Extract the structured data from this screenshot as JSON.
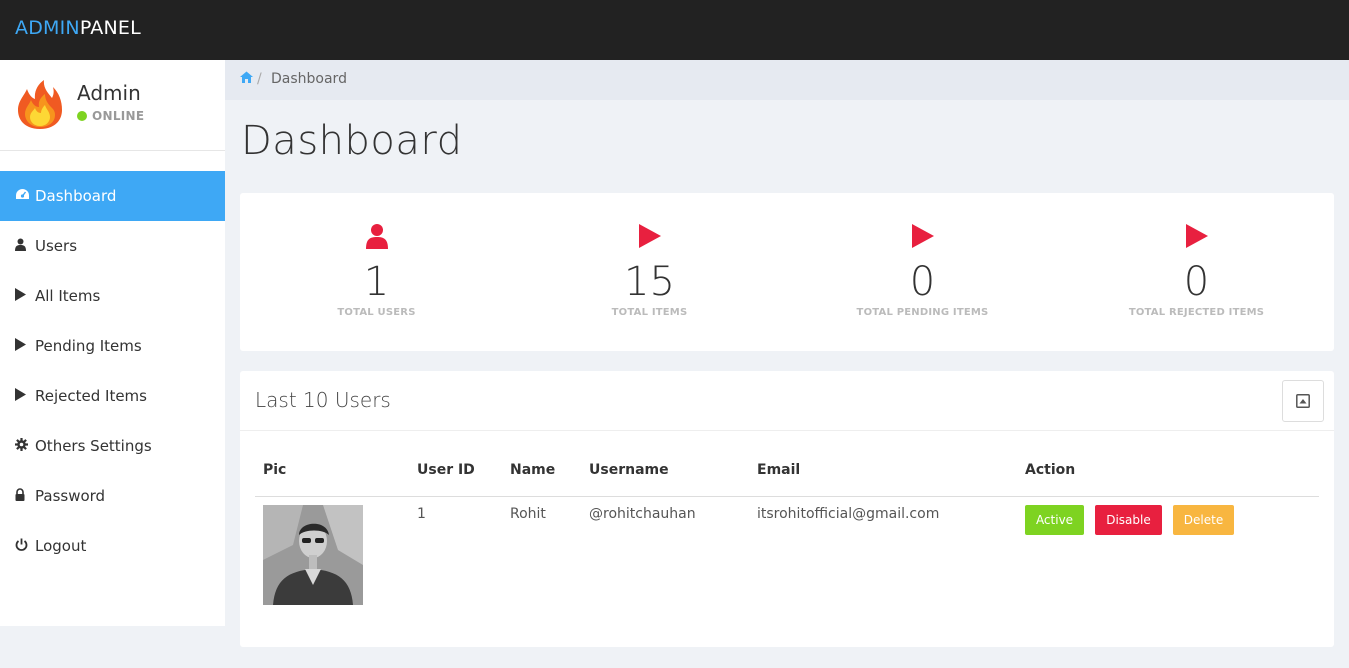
{
  "brand": {
    "part1": "ADMIN",
    "part2": "PANEL"
  },
  "profile": {
    "name": "Admin",
    "status": "ONLINE",
    "avatar_icon": "flame-icon"
  },
  "nav": {
    "items": [
      {
        "label": "Dashboard",
        "icon": "dashboard-icon",
        "active": true
      },
      {
        "label": "Users",
        "icon": "user-icon"
      },
      {
        "label": "All Items",
        "icon": "play-icon"
      },
      {
        "label": "Pending Items",
        "icon": "play-icon"
      },
      {
        "label": "Rejected Items",
        "icon": "play-icon"
      },
      {
        "label": "Others Settings",
        "icon": "gear-icon"
      },
      {
        "label": "Password",
        "icon": "lock-icon"
      },
      {
        "label": "Logout",
        "icon": "power-icon"
      }
    ]
  },
  "breadcrumb": {
    "sep": "/",
    "current": "Dashboard"
  },
  "page": {
    "title": "Dashboard"
  },
  "stats": [
    {
      "value": "1",
      "label": "TOTAL USERS",
      "icon": "user-icon"
    },
    {
      "value": "15",
      "label": "TOTAL ITEMS",
      "icon": "play-icon"
    },
    {
      "value": "0",
      "label": "TOTAL PENDING ITEMS",
      "icon": "play-icon"
    },
    {
      "value": "0",
      "label": "TOTAL REJECTED ITEMS",
      "icon": "play-icon"
    }
  ],
  "users_panel": {
    "title": "Last 10 Users",
    "columns": [
      "Pic",
      "User ID",
      "Name",
      "Username",
      "Email",
      "Action"
    ],
    "rows": [
      {
        "user_id": "1",
        "name": "Rohit",
        "username": "@rohitchauhan",
        "email": "itsrohitofficial@gmail.com"
      }
    ],
    "actions": {
      "active": "Active",
      "disable": "Disable",
      "delete": "Delete"
    }
  },
  "colors": {
    "accent": "#3ea8f5",
    "danger": "#e8203f",
    "success": "#7ed321",
    "warning": "#f8b640",
    "topbar": "#222222"
  }
}
